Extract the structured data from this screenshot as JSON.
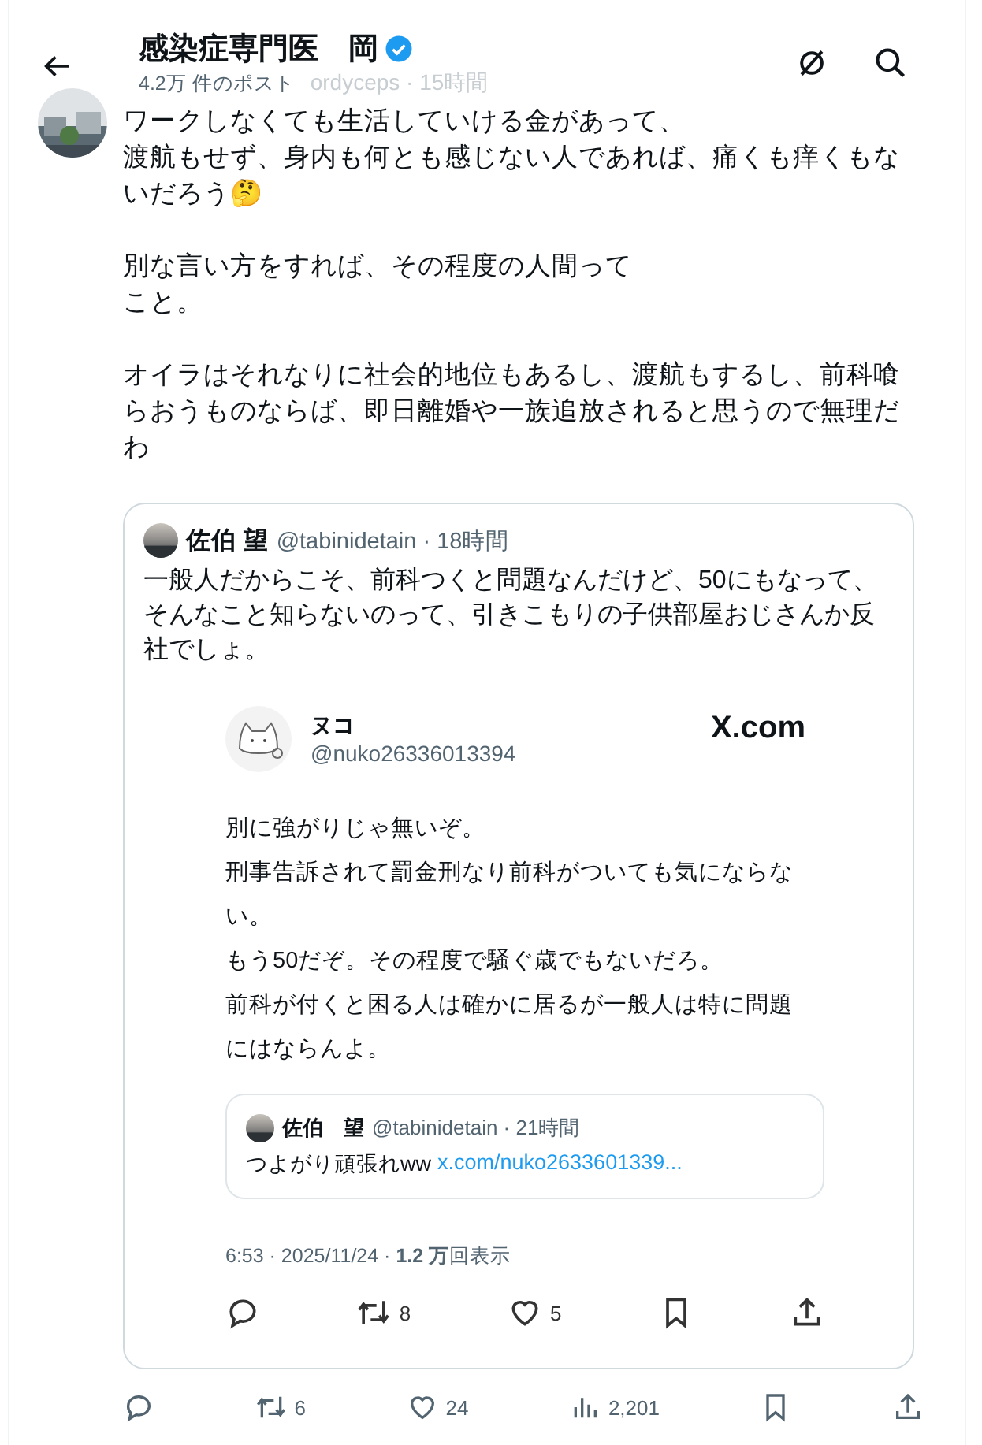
{
  "header": {
    "title": "感染症専門医　岡",
    "verified": true,
    "post_count": "4.2万 件のポスト"
  },
  "background_post": {
    "meta": "ordyceps · 15時間"
  },
  "post": {
    "paragraphs": [
      [
        "ワークしなくても生活していける金があって、",
        "渡航もせず、身内も何とも感じない人であれば、痛くも痒くもないだろう🤔"
      ],
      [
        "別な言い方をすれば、その程度の人間って",
        "こと。"
      ],
      [
        "オイラはそれなりに社会的地位もあるし、渡航もするし、前科喰らおうものならば、即日離婚や一族追放されると思うので無理だわ"
      ]
    ]
  },
  "quote": {
    "name": "佐伯 望",
    "handle": "@tabinidetain · 18時間",
    "text": "一般人だからこそ、前科つくと問題なんだけど、50にもなって、そんなこと知らないのって、引きこもりの子供部屋おじさんか反社でしょ。",
    "screenshot": {
      "name": "ヌコ",
      "handle": "@nuko26336013394",
      "brand": "X.com",
      "lines": [
        "別に強がりじゃ無いぞ。",
        "刑事告訴されて罰金刑なり前科がついても気にならない。",
        "もう50だぞ。その程度で騒ぐ歳でもないだろ。",
        "前科が付くと困る人は確かに居るが一般人は特に問題にはならんよ。"
      ],
      "inner_quote": {
        "name": "佐伯　望",
        "handle": "@tabinidetain · 21時間",
        "text": "つよがり頑張れww",
        "link": "x.com/nuko2633601339..."
      },
      "meta": "6:53 · 2025/11/24 · **1.2 万**回表示",
      "actions": [
        {
          "kind": "reply"
        },
        {
          "kind": "repost",
          "count": "8"
        },
        {
          "kind": "like",
          "count": "5"
        },
        {
          "kind": "bookmark"
        },
        {
          "kind": "share"
        }
      ]
    }
  },
  "actions": [
    {
      "kind": "reply"
    },
    {
      "kind": "repost",
      "count": "6"
    },
    {
      "kind": "like",
      "count": "24"
    },
    {
      "kind": "views",
      "count": "2,201"
    },
    {
      "kind": "bookmark"
    },
    {
      "kind": "share"
    }
  ]
}
